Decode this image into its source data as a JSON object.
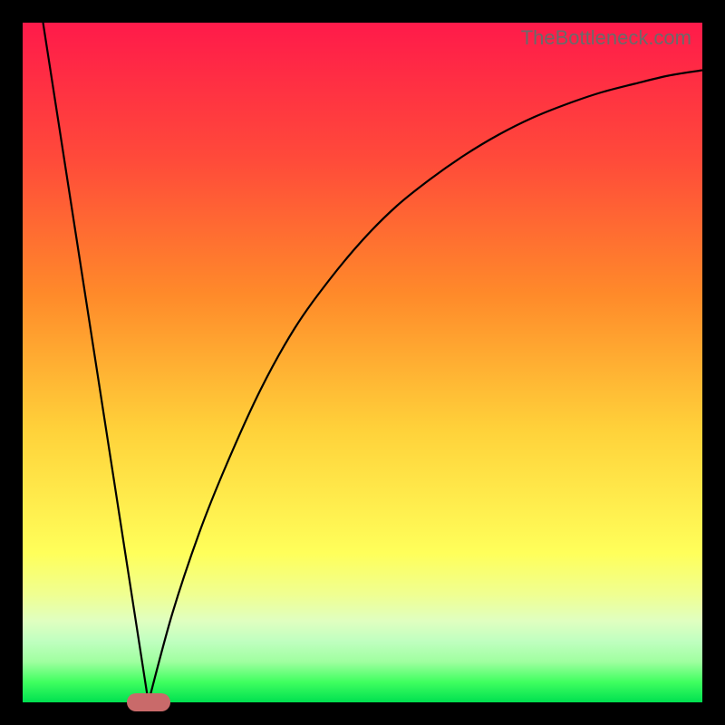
{
  "watermark": "TheBottleneck.com",
  "chart_data": {
    "type": "line",
    "title": "",
    "xlabel": "",
    "ylabel": "",
    "xlim": [
      0,
      100
    ],
    "ylim": [
      0,
      100
    ],
    "grid": false,
    "legend": false,
    "background": "rainbow-gradient-red-top-green-bottom",
    "series": [
      {
        "name": "left-segment",
        "x": [
          3,
          18.5
        ],
        "y": [
          100,
          0
        ]
      },
      {
        "name": "right-curve",
        "x": [
          18.5,
          22,
          26,
          30,
          35,
          40,
          45,
          50,
          55,
          60,
          65,
          70,
          75,
          80,
          85,
          90,
          95,
          100
        ],
        "y": [
          0,
          13,
          25,
          35,
          46,
          55,
          62,
          68,
          73,
          77,
          80.5,
          83.5,
          86,
          88,
          89.7,
          91,
          92.2,
          93
        ]
      }
    ],
    "marker": {
      "x": 18.5,
      "y": 0,
      "color": "#c96a6a",
      "shape": "pill"
    },
    "notes": "Black frame around plot; curve is thin black; no axis ticks or labels visible."
  }
}
